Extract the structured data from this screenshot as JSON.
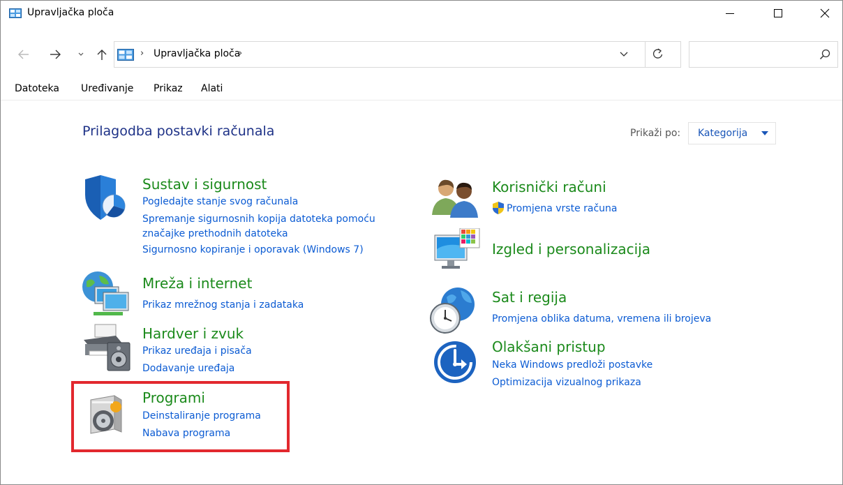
{
  "window": {
    "title": "Upravljačka ploča"
  },
  "address": {
    "crumbs": [
      "Upravljačka ploča"
    ],
    "separator": "›",
    "search_placeholder": ""
  },
  "menu": [
    "Datoteka",
    "Uređivanje",
    "Prikaz",
    "Alati"
  ],
  "header": {
    "title": "Prilagodba postavki računala",
    "view_by_label": "Prikaži po:",
    "view_by_value": "Kategorija"
  },
  "categories_left": [
    {
      "title": "Sustav i sigurnost",
      "icon": "shield-icon",
      "links": [
        "Pogledajte stanje svog računala",
        "Spremanje sigurnosnih kopija datoteka pomoću",
        "značajke prethodnih datoteka",
        "Sigurnosno kopiranje i oporavak (Windows 7)"
      ]
    },
    {
      "title": "Mreža i internet",
      "icon": "network-globe-icon",
      "links": [
        "Prikaz mrežnog stanja i zadataka"
      ]
    },
    {
      "title": "Hardver i zvuk",
      "icon": "printer-speaker-icon",
      "links": [
        "Prikaz uređaja i pisača",
        "Dodavanje uređaja"
      ]
    },
    {
      "title": "Programi",
      "icon": "programs-disc-icon",
      "links": [
        "Deinstaliranje programa",
        "Nabava programa"
      ]
    }
  ],
  "categories_right": [
    {
      "title": "Korisnički računi",
      "icon": "users-icon",
      "links": [
        "Promjena vrste računa"
      ]
    },
    {
      "title": "Izgled i personalizacija",
      "icon": "monitor-palette-icon",
      "links": []
    },
    {
      "title": "Sat i regija",
      "icon": "clock-globe-icon",
      "links": [
        "Promjena oblika datuma, vremena ili brojeva"
      ]
    },
    {
      "title": "Olakšani pristup",
      "icon": "accessibility-icon",
      "links": [
        "Neka Windows predloži postavke",
        "Optimizacija vizualnog prikaza"
      ]
    }
  ],
  "colors": {
    "title_blue": "#1e3287",
    "category_green": "#1b8a1b",
    "link_blue": "#0b5bd3",
    "highlight_red": "#e2282e"
  }
}
